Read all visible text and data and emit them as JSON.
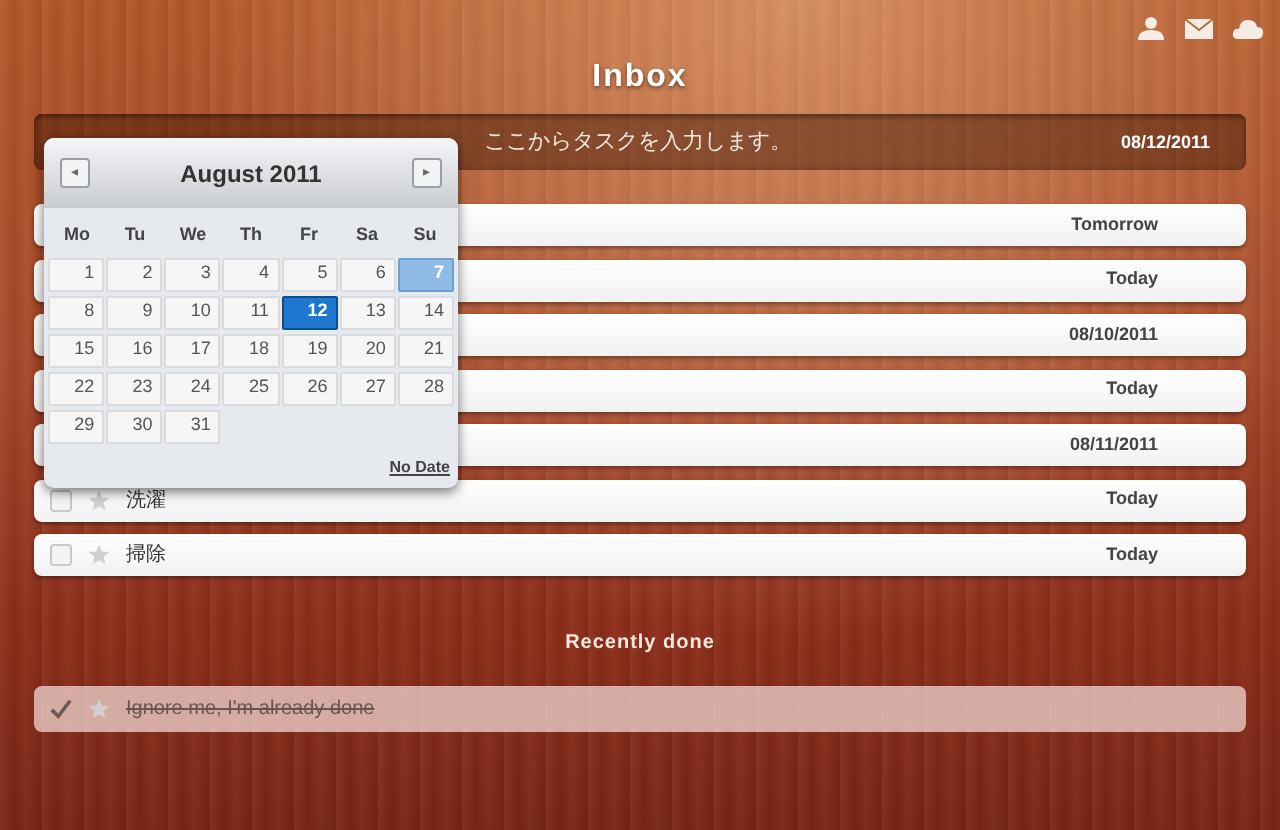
{
  "header": {
    "title": "Inbox"
  },
  "new_task": {
    "placeholder": "ここからタスクを入力します。",
    "due": "08/12/2011"
  },
  "calendar": {
    "month": "August 2011",
    "prev": "◂",
    "next": "▸",
    "weekdays": [
      "Mo",
      "Tu",
      "We",
      "Th",
      "Fr",
      "Sa",
      "Su"
    ],
    "days": [
      {
        "label": "1",
        "selected": false,
        "today": false
      },
      {
        "label": "2",
        "selected": false,
        "today": false
      },
      {
        "label": "3",
        "selected": false,
        "today": false
      },
      {
        "label": "4",
        "selected": false,
        "today": false
      },
      {
        "label": "5",
        "selected": false,
        "today": false
      },
      {
        "label": "6",
        "selected": false,
        "today": false
      },
      {
        "label": "7",
        "selected": false,
        "today": true
      },
      {
        "label": "8",
        "selected": false,
        "today": false
      },
      {
        "label": "9",
        "selected": false,
        "today": false
      },
      {
        "label": "10",
        "selected": false,
        "today": false
      },
      {
        "label": "11",
        "selected": false,
        "today": false
      },
      {
        "label": "12",
        "selected": true,
        "today": false
      },
      {
        "label": "13",
        "selected": false,
        "today": false
      },
      {
        "label": "14",
        "selected": false,
        "today": false
      },
      {
        "label": "15",
        "selected": false,
        "today": false
      },
      {
        "label": "16",
        "selected": false,
        "today": false
      },
      {
        "label": "17",
        "selected": false,
        "today": false
      },
      {
        "label": "18",
        "selected": false,
        "today": false
      },
      {
        "label": "19",
        "selected": false,
        "today": false
      },
      {
        "label": "20",
        "selected": false,
        "today": false
      },
      {
        "label": "21",
        "selected": false,
        "today": false
      },
      {
        "label": "22",
        "selected": false,
        "today": false
      },
      {
        "label": "23",
        "selected": false,
        "today": false
      },
      {
        "label": "24",
        "selected": false,
        "today": false
      },
      {
        "label": "25",
        "selected": false,
        "today": false
      },
      {
        "label": "26",
        "selected": false,
        "today": false
      },
      {
        "label": "27",
        "selected": false,
        "today": false
      },
      {
        "label": "28",
        "selected": false,
        "today": false
      },
      {
        "label": "29",
        "selected": false,
        "today": false
      },
      {
        "label": "30",
        "selected": false,
        "today": false
      },
      {
        "label": "31",
        "selected": false,
        "today": false
      }
    ],
    "no_date": "No Date"
  },
  "tasks": [
    {
      "due": "Tomorrow"
    },
    {
      "due": "Today"
    },
    {
      "due": "08/10/2011"
    },
    {
      "due": "Today"
    },
    {
      "due": "08/11/2011"
    },
    {
      "title": "洗濯",
      "due": "Today",
      "checked": false,
      "starred": false
    },
    {
      "title": "掃除",
      "due": "Today",
      "checked": false,
      "starred": false
    }
  ],
  "done_section": {
    "title": "Recently done",
    "tasks": [
      {
        "title": "Ignore me, I'm already done",
        "checked": true,
        "starred": false
      }
    ]
  }
}
